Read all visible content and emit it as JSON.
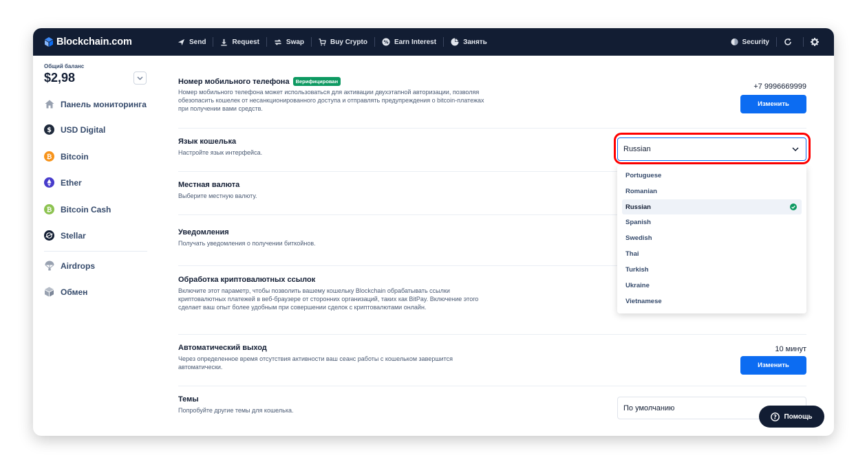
{
  "header": {
    "logo_text": "Blockchain.com",
    "nav": [
      {
        "label": "Send",
        "icon": "send-icon"
      },
      {
        "label": "Request",
        "icon": "download-icon"
      },
      {
        "label": "Swap",
        "icon": "swap-icon"
      },
      {
        "label": "Buy Crypto",
        "icon": "cart-icon"
      },
      {
        "label": "Earn Interest",
        "icon": "interest-icon"
      },
      {
        "label": "Занять",
        "icon": "pie-chart-icon"
      }
    ],
    "security_label": "Security"
  },
  "sidebar": {
    "balance_label": "Общий баланс",
    "balance_value": "$2,98",
    "items": [
      {
        "label": "Панель мониторинга",
        "icon": "home-icon"
      },
      {
        "label": "USD Digital",
        "icon": "usd-digital-icon"
      },
      {
        "label": "Bitcoin",
        "icon": "bitcoin-icon"
      },
      {
        "label": "Ether",
        "icon": "ether-icon"
      },
      {
        "label": "Bitcoin Cash",
        "icon": "bitcoin-cash-icon"
      },
      {
        "label": "Stellar",
        "icon": "stellar-icon"
      },
      {
        "label": "Airdrops",
        "icon": "parachute-icon"
      },
      {
        "label": "Обмен",
        "icon": "exchange-icon"
      }
    ]
  },
  "settings": {
    "phone": {
      "title": "Номер мобильного телефона",
      "badge": "Верифицирован",
      "desc": "Номер мобильного телефона может использоваться для активации двухэтапной авторизации, позволяя обезопасить кошелек от несанкционированного доступа и отправлять предупреждения о bitcoin-платежах при получении вами средств.",
      "value": "+7 9996669999",
      "button": "Изменить"
    },
    "language": {
      "title": "Язык кошелька",
      "desc": "Настройте язык интерфейса.",
      "selected": "Russian",
      "options": [
        "Portuguese",
        "Romanian",
        "Russian",
        "Spanish",
        "Swedish",
        "Thai",
        "Turkish",
        "Ukraine",
        "Vietnamese"
      ]
    },
    "currency": {
      "title": "Местная валюта",
      "desc": "Выберите местную валюту."
    },
    "notifications": {
      "title": "Уведомления",
      "desc": "Получать уведомления о получении биткойнов."
    },
    "crypto_links": {
      "title": "Обработка криптовалютных ссылок",
      "desc": "Включите этот параметр, чтобы позволить вашему кошельку Blockchain обрабатывать ссылки криптовалютных платежей в веб-браузере от сторонних организаций, таких как BitPay. Включение этого сделает ваш опыт более удобным при совершении сделок с криптовалютами онлайн."
    },
    "auto_logout": {
      "title": "Автоматический выход",
      "desc": "Через определенное время отсутствия активности ваш сеанс работы с кошельком завершится автоматически.",
      "value": "10 минут",
      "button": "Изменить"
    },
    "themes": {
      "title": "Темы",
      "desc": "Попробуйте другие темы для кошелька.",
      "selected": "По умолчанию"
    }
  },
  "help_label": "Помощь",
  "colors": {
    "navy": "#121d33",
    "primary_blue": "#0c6cf2",
    "verified_green": "#0d9961",
    "highlight_red": "#ff0000"
  }
}
